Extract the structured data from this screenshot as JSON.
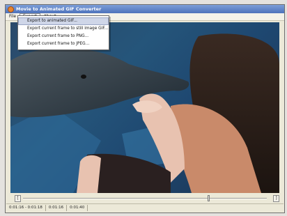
{
  "window": {
    "title": "Movie to Animated GIF Converter"
  },
  "menubar": {
    "items": [
      {
        "label": "File"
      },
      {
        "label": "Export"
      },
      {
        "label": "About..."
      }
    ]
  },
  "export_menu": {
    "items": [
      {
        "label": "Export to animated GIF..."
      },
      {
        "label": "Export current frame to still image GIF..."
      },
      {
        "label": "Export current frame to PNG..."
      },
      {
        "label": "Export current frame to JPEG..."
      }
    ]
  },
  "seek": {
    "left_button": "[",
    "right_button": "]",
    "position": 0.76
  },
  "status": {
    "cells": [
      "0:01:16 - 0:01:18",
      "0:01:16",
      "0:01:40"
    ]
  },
  "colors": {
    "title_bar": "#4d72bb",
    "menu_highlight": "#cfd6e8",
    "video_water": "#25557a"
  }
}
